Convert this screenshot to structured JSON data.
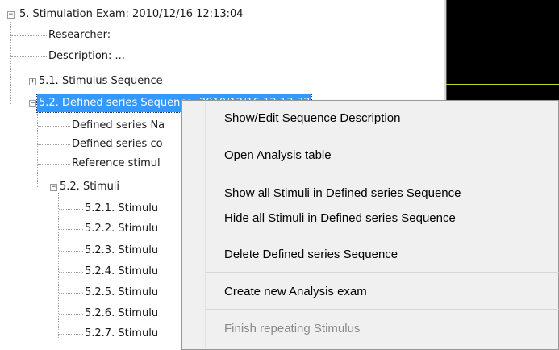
{
  "tree": {
    "nodes": [
      {
        "label": "5. Stimulation Exam: 2010/12/16 12:13:04",
        "expander": "−"
      },
      {
        "label": "Researcher:"
      },
      {
        "label": "Description: ..."
      },
      {
        "label": "5.1. Stimulus Sequence",
        "expander": "+"
      },
      {
        "label": "5.2. Defined series Sequence: 2010/12/16 12:13:32",
        "expander": "−",
        "selected": true
      },
      {
        "label": "Defined series Na"
      },
      {
        "label": "Defined series co"
      },
      {
        "label": "Reference stimul"
      },
      {
        "label": "5.2. Stimuli",
        "expander": "−"
      },
      {
        "label": "5.2.1. Stimulu"
      },
      {
        "label": "5.2.2. Stimulu"
      },
      {
        "label": "5.2.3. Stimulu"
      },
      {
        "label": "5.2.4. Stimulu"
      },
      {
        "label": "5.2.5. Stimulu"
      },
      {
        "label": "5.2.6. Stimulu"
      },
      {
        "label": "5.2.7. Stimulu"
      }
    ]
  },
  "context_menu": {
    "items": [
      {
        "label": "Show/Edit Sequence Description",
        "enabled": true
      },
      {
        "label": "Open Analysis table",
        "enabled": true
      },
      {
        "label": "Show all Stimuli in Defined series Sequence",
        "enabled": true
      },
      {
        "label": "Hide all Stimuli in Defined series Sequence",
        "enabled": true
      },
      {
        "label": "Delete Defined series Sequence",
        "enabled": true
      },
      {
        "label": "Create new Analysis exam",
        "enabled": true
      },
      {
        "label": "Finish repeating Stimulus",
        "enabled": false
      }
    ]
  },
  "colors": {
    "selection": "#3399ff",
    "preview_background": "#000000",
    "preview_line": "#c8d21e",
    "disabled_text": "#8a8a8a"
  }
}
